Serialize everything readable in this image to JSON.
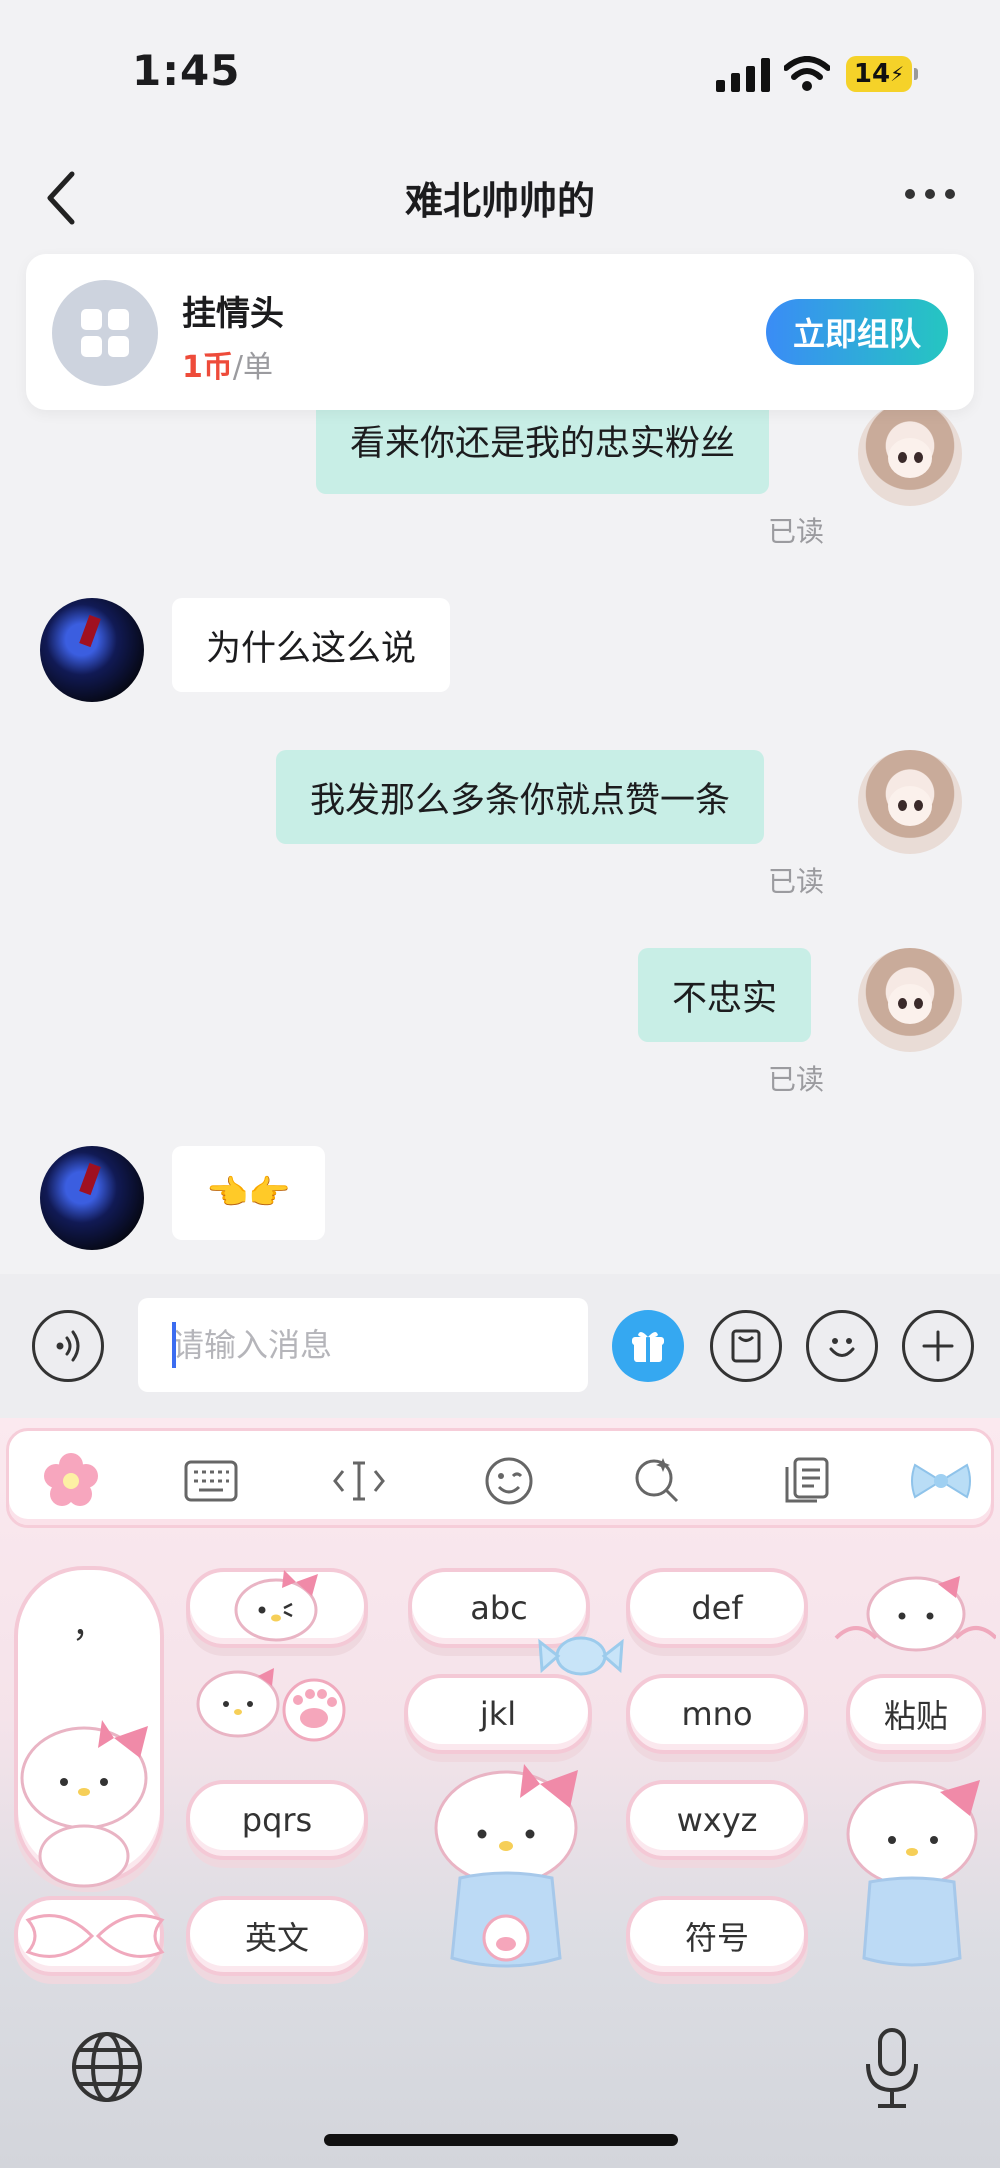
{
  "status": {
    "time": "1:45",
    "battery": "14"
  },
  "nav": {
    "title": "难北帅帅的"
  },
  "service": {
    "name": "挂情头",
    "price_amount": "1币",
    "price_unit": "/单",
    "button": "立即组队"
  },
  "messages": [
    {
      "from": "me",
      "text": "看来你还是我的忠实粉丝",
      "status": "已读"
    },
    {
      "from": "them",
      "text": "为什么这么说"
    },
    {
      "from": "me",
      "text": "我发那么多条你就点赞一条",
      "status": "已读"
    },
    {
      "from": "me",
      "text": "不忠实",
      "status": "已读"
    },
    {
      "from": "them",
      "text": "👈👉"
    }
  ],
  "input": {
    "placeholder": "请输入消息"
  },
  "keyboard": {
    "toolbar": [
      "flower-icon",
      "keyboard-icon",
      "cursor-icon",
      "emoji-icon",
      "search-icon",
      "clipboard-icon",
      "bow-icon"
    ],
    "keys": {
      "punct_top": "，",
      "punct_mid": "？",
      "punct_bot": "！",
      "abc": "abc",
      "def": "def",
      "jkl": "jkl",
      "mno": "mno",
      "paste": "粘贴",
      "pqrs": "pqrs",
      "wxyz": "wxyz",
      "english": "英文",
      "symbols": "符号"
    }
  },
  "colors": {
    "accent_gradient_start": "#3a8cf6",
    "accent_gradient_end": "#25c6c1",
    "bubble_me": "#c8eee6",
    "price_red": "#ee4b3a"
  }
}
